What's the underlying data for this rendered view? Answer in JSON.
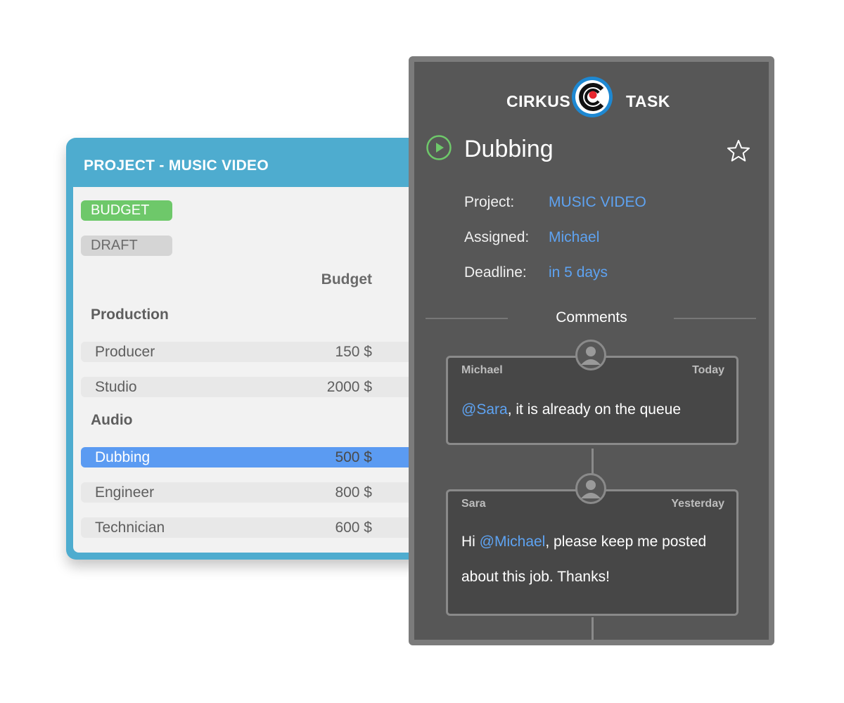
{
  "project": {
    "title": "PROJECT - MUSIC VIDEO",
    "tags": [
      "BUDGET",
      "DRAFT"
    ],
    "column_header": "Budget",
    "sections": [
      {
        "label": "Production",
        "rows": [
          {
            "name": "Producer",
            "amount": "150 $"
          },
          {
            "name": "Studio",
            "amount": "2000 $"
          }
        ]
      },
      {
        "label": "Audio",
        "rows": [
          {
            "name": "Dubbing",
            "amount": "500 $",
            "selected": true
          },
          {
            "name": "Engineer",
            "amount": "800 $"
          },
          {
            "name": "Technician",
            "amount": "600 $"
          }
        ]
      }
    ],
    "colors": {
      "header": "#4eaccf",
      "budget_tag": "#6ec86a",
      "selected_row": "#5b9bf2"
    }
  },
  "task": {
    "brand_left": "CIRKUS",
    "brand_right": "TASK",
    "logo_icon": "cirkus-logo-icon",
    "status_icon": "play-circle-icon",
    "favorite_icon": "star-outline-icon",
    "title": "Dubbing",
    "fields": [
      {
        "label": "Project:",
        "value": "MUSIC VIDEO"
      },
      {
        "label": "Assigned:",
        "value": "Michael"
      },
      {
        "label": "Deadline:",
        "value": "in 5 days"
      }
    ],
    "comments_heading": "Comments",
    "comments": [
      {
        "author": "Michael",
        "time": "Today",
        "mention": "@Sara",
        "text_after": ", it is already on the queue"
      },
      {
        "author": "Sara",
        "time": "Yesterday",
        "text_before": "Hi ",
        "mention": "@Michael",
        "text_after": ", please keep me posted about this job. Thanks!"
      }
    ],
    "colors": {
      "panel": "#575757",
      "link": "#5ea3f2",
      "play": "#6ec86a"
    }
  }
}
